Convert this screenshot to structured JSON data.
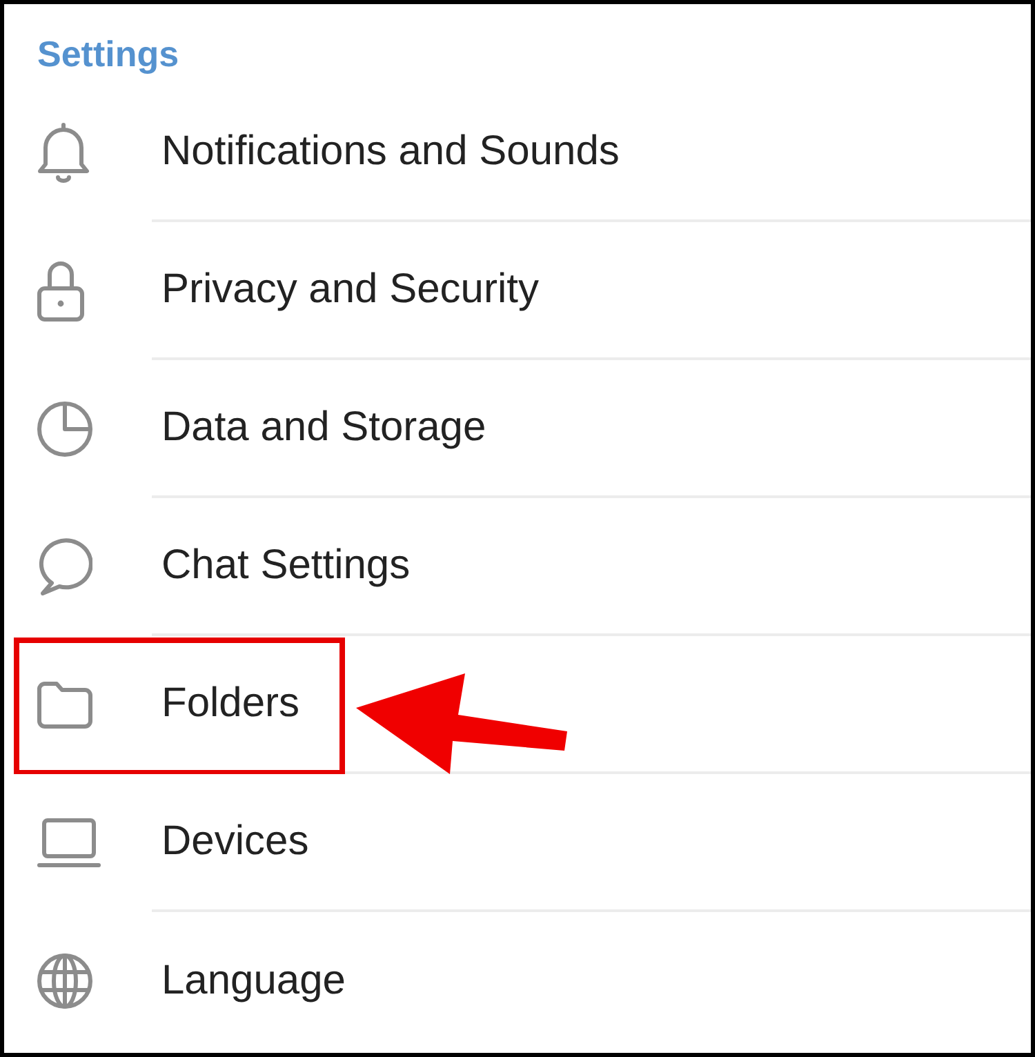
{
  "header": {
    "title": "Settings"
  },
  "items": [
    {
      "label": "Notifications and Sounds",
      "highlighted": false
    },
    {
      "label": "Privacy and Security",
      "highlighted": false
    },
    {
      "label": "Data and Storage",
      "highlighted": false
    },
    {
      "label": "Chat Settings",
      "highlighted": false
    },
    {
      "label": "Folders",
      "highlighted": true
    },
    {
      "label": "Devices",
      "highlighted": false
    },
    {
      "label": "Language",
      "highlighted": false
    }
  ]
}
